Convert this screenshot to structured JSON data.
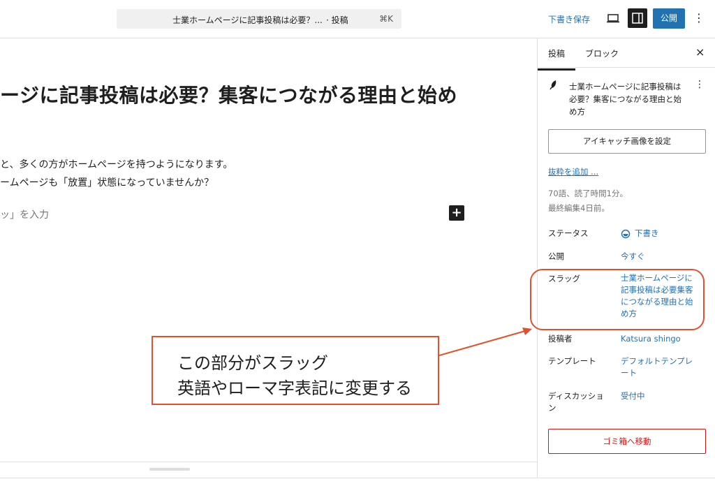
{
  "topbar": {
    "command_title": "士業ホームページに記事投稿は必要？...",
    "command_type": "· 投稿",
    "command_shortcut": "⌘K",
    "save_draft": "下書き保存",
    "publish": "公開",
    "more": "⋮"
  },
  "editor": {
    "title": "ージに記事投稿は必要？集客につながる理由と始め",
    "paragraph1": "と、多くの方がホームページを持つようになります。",
    "paragraph2": "ームページも「放置」状態になっていませんか？",
    "placeholder": "ッ」を入力",
    "add_block": "+"
  },
  "sidebar": {
    "tab_post": "投稿",
    "tab_block": "ブロック",
    "close": "×",
    "post_title": "士業ホームページに記事投稿は必要？集客につながる理由と始め方",
    "featured_image_button": "アイキャッチ画像を設定",
    "excerpt_link": "抜粋を追加 ...",
    "word_count": "70語、読了時間1分。",
    "last_edited": "最終編集4日前。",
    "rows": {
      "status_label": "ステータス",
      "status_value": "下書き",
      "publish_label": "公開",
      "publish_value": "今すぐ",
      "slug_label": "スラッグ",
      "slug_value": "士業ホームページに記事投稿は必要集客につながる理由と始め方",
      "author_label": "投稿者",
      "author_value": "Katsura shingo",
      "template_label": "テンプレート",
      "template_value": "デフォルトテンプレート",
      "discussion_label": "ディスカッション",
      "discussion_value": "受付中"
    },
    "trash_button": "ゴミ箱へ移動"
  },
  "annotation": {
    "line1": "この部分がスラッグ",
    "line2": "英語やローマ字表記に変更する",
    "color": "#e0512d"
  },
  "colors": {
    "accent": "#2271b1",
    "danger": "#cc1818",
    "dark": "#1e1e1e"
  }
}
